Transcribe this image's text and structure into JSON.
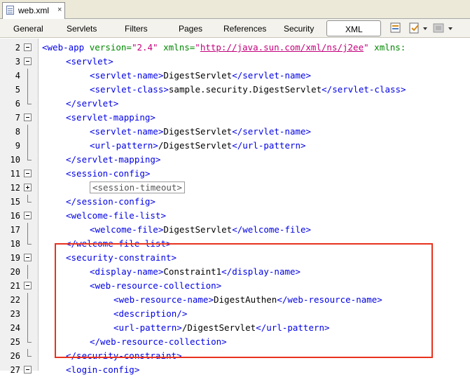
{
  "file_tab": {
    "name": "web.xml",
    "close": "×"
  },
  "view_tabs": [
    "General",
    "Servlets",
    "Filters",
    "Pages",
    "References",
    "Security",
    "XML"
  ],
  "toolbar": {
    "icons": [
      "validate-icon",
      "check-xml-icon",
      "run-icon"
    ]
  },
  "lines": [
    {
      "n": "2",
      "fold": "minus",
      "indent": 0,
      "parts": [
        {
          "t": "<web-app",
          "c": "tag"
        },
        {
          "t": " version=",
          "c": "attr"
        },
        {
          "t": "\"2.4\"",
          "c": "val"
        },
        {
          "t": " xmlns=",
          "c": "attr"
        },
        {
          "t": "\"",
          "c": "val"
        },
        {
          "t": "http://java.sun.com/xml/ns/j2ee",
          "c": "url"
        },
        {
          "t": "\"",
          "c": "val"
        },
        {
          "t": " xmlns:",
          "c": "attr"
        }
      ]
    },
    {
      "n": "3",
      "fold": "minus",
      "indent": 1,
      "parts": [
        {
          "t": "<servlet>",
          "c": "tag"
        }
      ]
    },
    {
      "n": "4",
      "fold": "line",
      "indent": 2,
      "parts": [
        {
          "t": "<servlet-name>",
          "c": "tag"
        },
        {
          "t": "DigestServlet",
          "c": "txt"
        },
        {
          "t": "</servlet-name>",
          "c": "tag"
        }
      ]
    },
    {
      "n": "5",
      "fold": "line",
      "indent": 2,
      "parts": [
        {
          "t": "<servlet-class>",
          "c": "tag"
        },
        {
          "t": "sample.security.DigestServlet",
          "c": "txt"
        },
        {
          "t": "</servlet-class>",
          "c": "tag"
        }
      ]
    },
    {
      "n": "6",
      "fold": "end",
      "indent": 1,
      "parts": [
        {
          "t": "</servlet>",
          "c": "tag"
        }
      ]
    },
    {
      "n": "7",
      "fold": "minus",
      "indent": 1,
      "parts": [
        {
          "t": "<servlet-mapping>",
          "c": "tag"
        }
      ]
    },
    {
      "n": "8",
      "fold": "line",
      "indent": 2,
      "parts": [
        {
          "t": "<servlet-name>",
          "c": "tag"
        },
        {
          "t": "DigestServlet",
          "c": "txt"
        },
        {
          "t": "</servlet-name>",
          "c": "tag"
        }
      ]
    },
    {
      "n": "9",
      "fold": "line",
      "indent": 2,
      "parts": [
        {
          "t": "<url-pattern>",
          "c": "tag"
        },
        {
          "t": "/DigestServlet",
          "c": "txt"
        },
        {
          "t": "</url-pattern>",
          "c": "tag"
        }
      ]
    },
    {
      "n": "10",
      "fold": "end",
      "indent": 1,
      "parts": [
        {
          "t": "</servlet-mapping>",
          "c": "tag"
        }
      ]
    },
    {
      "n": "11",
      "fold": "minus",
      "indent": 1,
      "parts": [
        {
          "t": "<session-config>",
          "c": "tag"
        }
      ]
    },
    {
      "n": "12",
      "fold": "plus",
      "indent": 2,
      "parts": [
        {
          "t": "<session-timeout>",
          "c": "collapsed"
        }
      ]
    },
    {
      "n": "15",
      "fold": "end",
      "indent": 1,
      "parts": [
        {
          "t": "</session-config>",
          "c": "tag"
        }
      ]
    },
    {
      "n": "16",
      "fold": "minus",
      "indent": 1,
      "parts": [
        {
          "t": "<welcome-file-list>",
          "c": "tag"
        }
      ]
    },
    {
      "n": "17",
      "fold": "line",
      "indent": 2,
      "parts": [
        {
          "t": "<welcome-file>",
          "c": "tag"
        },
        {
          "t": "DigestServlet",
          "c": "txt"
        },
        {
          "t": "</welcome-file>",
          "c": "tag"
        }
      ]
    },
    {
      "n": "18",
      "fold": "end",
      "indent": 1,
      "parts": [
        {
          "t": "</welcome-file-list>",
          "c": "tag"
        }
      ]
    },
    {
      "n": "19",
      "fold": "minus",
      "indent": 1,
      "parts": [
        {
          "t": "<security-constraint>",
          "c": "tag"
        }
      ]
    },
    {
      "n": "20",
      "fold": "line",
      "indent": 2,
      "parts": [
        {
          "t": "<display-name>",
          "c": "tag"
        },
        {
          "t": "Constraint1",
          "c": "txt"
        },
        {
          "t": "</display-name>",
          "c": "tag"
        }
      ]
    },
    {
      "n": "21",
      "fold": "minus",
      "indent": 2,
      "parts": [
        {
          "t": "<web-resource-collection>",
          "c": "tag"
        }
      ]
    },
    {
      "n": "22",
      "fold": "line",
      "indent": 3,
      "parts": [
        {
          "t": "<web-resource-name>",
          "c": "tag"
        },
        {
          "t": "DigestAuthen",
          "c": "txt"
        },
        {
          "t": "</web-resource-name>",
          "c": "tag"
        }
      ]
    },
    {
      "n": "23",
      "fold": "line",
      "indent": 3,
      "parts": [
        {
          "t": "<description/>",
          "c": "tag"
        }
      ]
    },
    {
      "n": "24",
      "fold": "line",
      "indent": 3,
      "parts": [
        {
          "t": "<url-pattern>",
          "c": "tag"
        },
        {
          "t": "/DigestServlet",
          "c": "txt"
        },
        {
          "t": "</url-pattern>",
          "c": "tag"
        }
      ]
    },
    {
      "n": "25",
      "fold": "end",
      "indent": 2,
      "parts": [
        {
          "t": "</web-resource-collection>",
          "c": "tag"
        }
      ]
    },
    {
      "n": "26",
      "fold": "end",
      "indent": 1,
      "parts": [
        {
          "t": "</security-constraint>",
          "c": "tag"
        }
      ]
    },
    {
      "n": "27",
      "fold": "minus",
      "indent": 1,
      "parts": [
        {
          "t": "<login-config>",
          "c": "tag"
        }
      ]
    }
  ],
  "colors": {
    "tag": "#0000e6",
    "attr": "#008800",
    "value": "#c4007c",
    "highlight": "#e8321e"
  }
}
